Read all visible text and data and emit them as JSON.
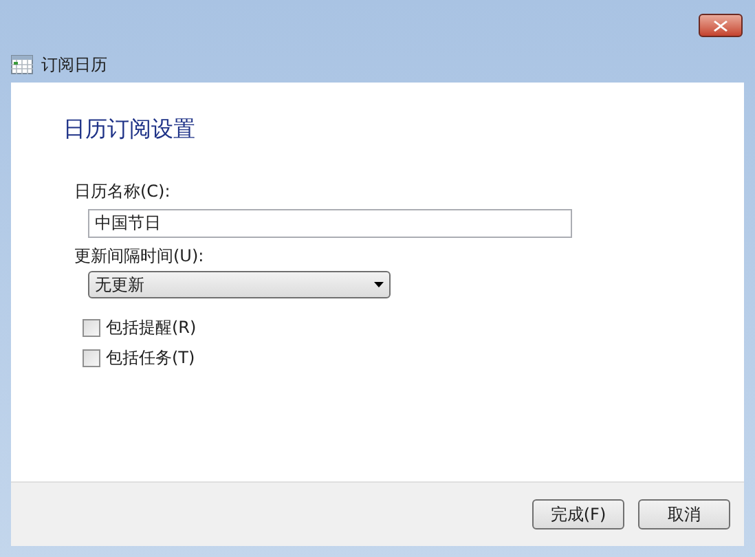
{
  "window": {
    "title": "订阅日历"
  },
  "heading": "日历订阅设置",
  "name_field": {
    "label": "日历名称(C):",
    "value": "中国节日"
  },
  "interval": {
    "label": "更新间隔时间(U):",
    "value": "无更新"
  },
  "options": [
    {
      "label": "包括提醒(R)",
      "checked": false
    },
    {
      "label": "包括任务(T)",
      "checked": false
    }
  ],
  "buttons": [
    "完成(F)",
    "取消"
  ]
}
